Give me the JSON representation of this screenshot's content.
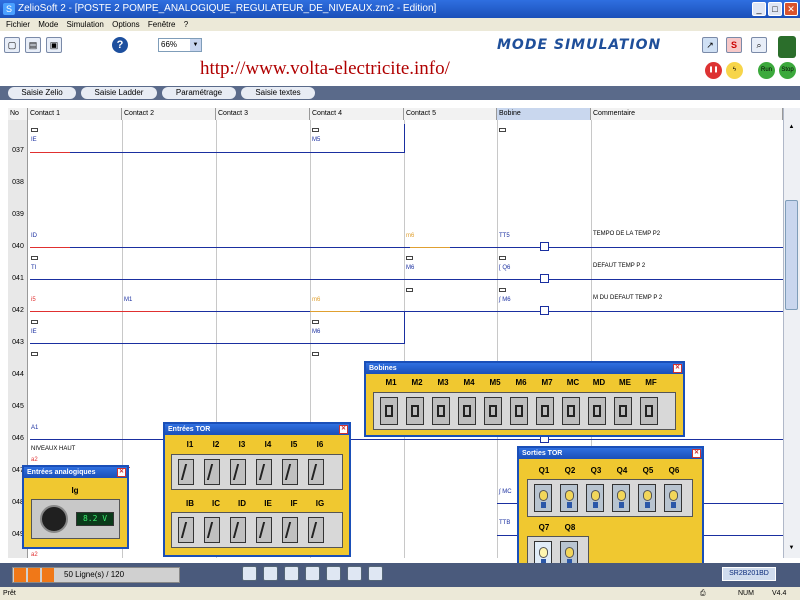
{
  "window": {
    "title": "ZelioSoft 2 - [POSTE 2 POMPE_ANALOGIQUE_REGULATEUR_DE_NIVEAUX.zm2 - Edition]",
    "logo_letter": "S"
  },
  "menu": [
    "Fichier",
    "Mode",
    "Simulation",
    "Options",
    "Fenêtre",
    "?"
  ],
  "toolbar": {
    "help_label": "?",
    "zoom": "66%",
    "mode_label": "MODE SIMULATION",
    "url": "http://www.volta-electricite.info/",
    "s_label": "S",
    "run_label": "Run",
    "stop_label": "Stop"
  },
  "tabs": [
    "Saisie Zelio",
    "Saisie Ladder",
    "Paramétrage",
    "Saisie textes"
  ],
  "grid": {
    "headers": [
      "No",
      "Contact 1",
      "Contact 2",
      "Contact 3",
      "Contact 4",
      "Contact 5",
      "Bobine",
      "Commentaire"
    ],
    "rows": [
      "037",
      "038",
      "039",
      "040",
      "041",
      "042",
      "043",
      "044",
      "045",
      "046",
      "047",
      "048",
      "049"
    ],
    "labels": {
      "r37c1": "IE",
      "r37c4": "M5",
      "r40c1": "ID",
      "r40c5": "m6",
      "r40coil": "TT5",
      "r41c1": "TI",
      "r41c5": "M6",
      "r41coil": "[ Q6",
      "r42c1": "i5",
      "r42c2": "M1",
      "r42c4": "m6",
      "r42coil": "∫ M6",
      "r43c1": "IE",
      "r43c4": "M6",
      "r46c1": "A1",
      "r46c1b": "NIVEAUX HAUT",
      "r47c1": "a2",
      "r48coil": "∫ MC",
      "r49coil": "TTB",
      "r49c1": "a2"
    },
    "comments": {
      "r40": "TEMPO DE LA TEMP P2",
      "r41": "DEFAUT TEMP P 2",
      "r42": "M DU DEFAUT TEMP P 2"
    }
  },
  "popups": {
    "analog": {
      "title": "Entrées analogiques",
      "input": "Ig",
      "value": "8.2 V"
    },
    "tor_in": {
      "title": "Entrées TOR",
      "row1": [
        "I1",
        "I2",
        "I3",
        "I4",
        "I5",
        "I6"
      ],
      "row2": [
        "IB",
        "IC",
        "ID",
        "IE",
        "IF",
        "IG"
      ]
    },
    "coils": {
      "title": "Bobines",
      "items": [
        "M1",
        "M2",
        "M3",
        "M4",
        "M5",
        "M6",
        "M7",
        "MC",
        "MD",
        "ME",
        "MF"
      ]
    },
    "tor_out": {
      "title": "Sorties TOR",
      "row1": [
        "Q1",
        "Q2",
        "Q3",
        "Q4",
        "Q5",
        "Q6"
      ],
      "row2": [
        "Q7",
        "Q8"
      ]
    }
  },
  "status": {
    "lines": "50 Ligne(s) / 120",
    "progress": 0.3,
    "ref": "SR2B201BD",
    "bottom_left": "Prêt",
    "num": "NUM",
    "version": "V4.4"
  },
  "colors": {
    "accent": "#1a4fb8",
    "popup": "#f0c830",
    "mode_text": "#1f4f9a",
    "url": "#b00000"
  }
}
